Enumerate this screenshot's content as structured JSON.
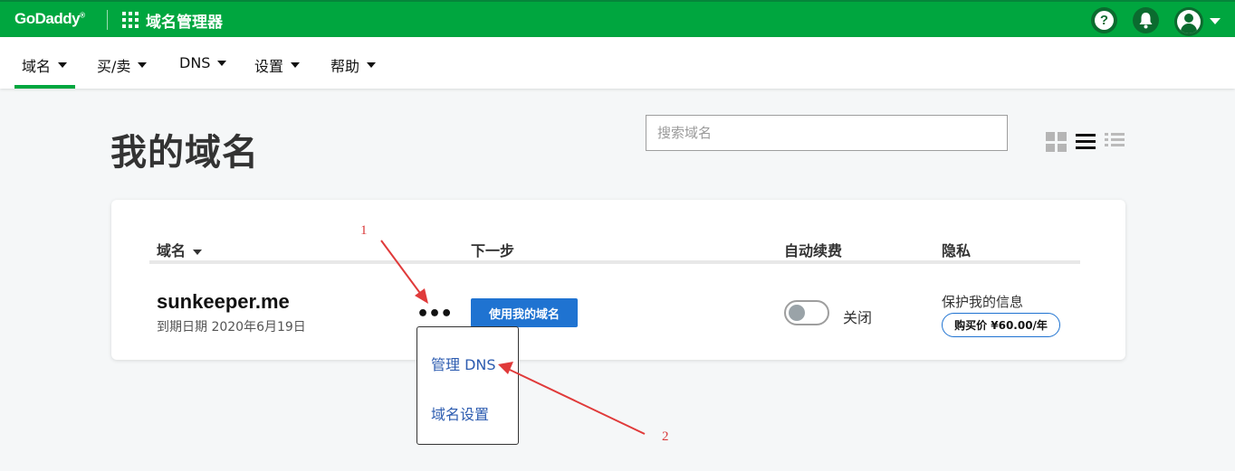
{
  "topbar": {
    "brand": "GoDaddy",
    "brand_mark": "®",
    "app_title": "域名管理器",
    "icons": [
      "apps-icon",
      "help-icon",
      "bell-icon",
      "avatar-icon",
      "chevron-down-icon"
    ],
    "help_glyph": "?",
    "color": "#00a63f"
  },
  "nav": {
    "items": [
      {
        "label": "域名",
        "active": true
      },
      {
        "label": "买/卖"
      },
      {
        "label": "DNS"
      },
      {
        "label": "设置"
      },
      {
        "label": "帮助"
      }
    ]
  },
  "page": {
    "title": "我的域名",
    "search_placeholder": "搜索域名",
    "view_icons": [
      "grid-view-icon",
      "list-view-icon",
      "compact-list-icon"
    ]
  },
  "table": {
    "headers": {
      "domain": "域名",
      "next_step": "下一步",
      "auto_renew": "自动续费",
      "privacy": "隐私"
    },
    "row": {
      "domain": "sunkeeper.me",
      "expiry": "到期日期 2020年6月19日",
      "more": "•••",
      "use_button": "使用我的域名",
      "auto_renew_state": "关闭",
      "privacy_label": "保护我的信息",
      "buy_button": "购买价 ¥60.00/年"
    }
  },
  "dropdown": {
    "items": [
      "管理 DNS",
      "域名设置"
    ]
  },
  "annotations": {
    "labels": [
      "1",
      "2"
    ],
    "color": "#d93a3a"
  }
}
